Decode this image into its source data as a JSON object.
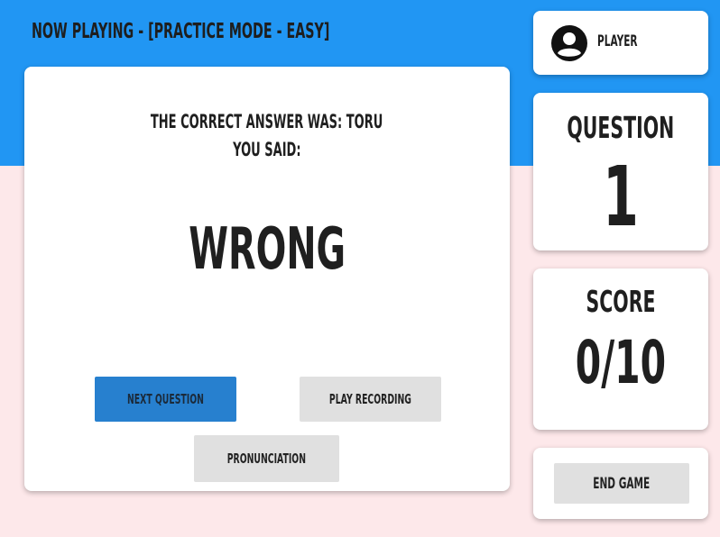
{
  "header": {
    "title": "NOW PLAYING - [PRACTICE MODE - EASY]"
  },
  "player": {
    "name": "PLAYER",
    "avatar_icon": "account-circle-icon"
  },
  "result": {
    "correct_answer_line": "THE CORRECT ANSWER WAS: TORU",
    "you_said_line": "YOU SAID:",
    "verdict": "WRONG"
  },
  "buttons": {
    "next_question": "NEXT QUESTION",
    "play_recording": "PLAY RECORDING",
    "pronunciation": "PRONUNCIATION",
    "end_game": "END GAME"
  },
  "question": {
    "label": "QUESTION",
    "number": "1"
  },
  "score": {
    "label": "SCORE",
    "value": "0/10"
  },
  "colors": {
    "header_blue": "#2196f3",
    "background_pink": "#fde8ea",
    "primary_button": "#2780cf",
    "secondary_button": "#e0e0e0"
  }
}
